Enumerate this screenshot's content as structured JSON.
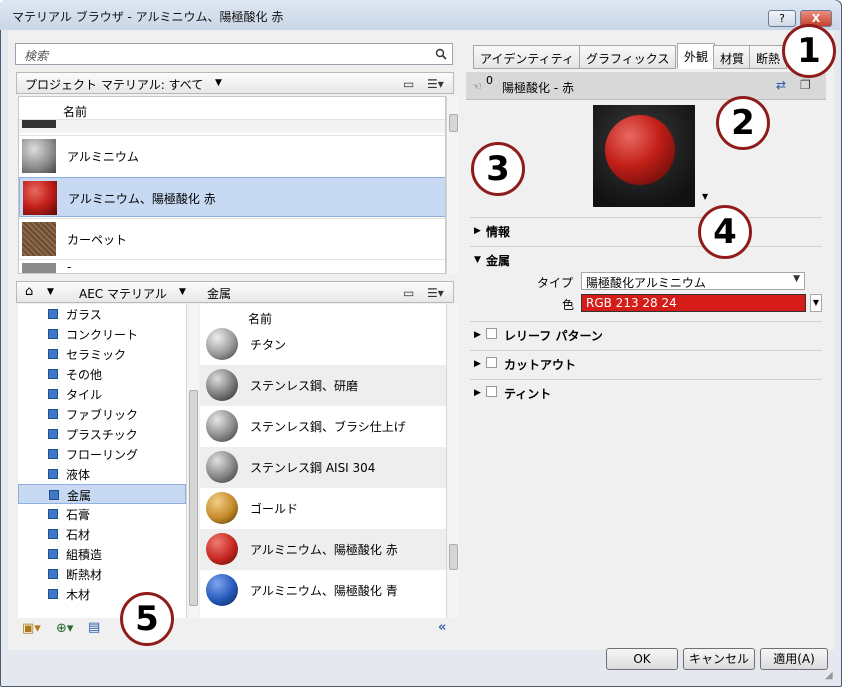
{
  "window": {
    "title": "マテリアル ブラウザ - アルミニウム、陽極酸化 赤",
    "help_label": "?",
    "close_label": "X"
  },
  "search": {
    "placeholder": "検索"
  },
  "project": {
    "dropdown_label": "プロジェクト マテリアル: すべて",
    "column_name": "名前",
    "items": [
      {
        "label": "アルミニウム",
        "icon": "sphere-gray"
      },
      {
        "label": "アルミニウム、陽極酸化 赤",
        "icon": "sphere-red",
        "selected": true
      },
      {
        "label": "カーペット",
        "icon": "texture-carpet"
      },
      {
        "label": "-",
        "icon": "texture-gray"
      }
    ]
  },
  "library": {
    "breadcrumb": [
      "AEC マテリアル",
      "金属"
    ],
    "column_name": "名前",
    "categories": [
      {
        "label": "ガラス"
      },
      {
        "label": "コンクリート"
      },
      {
        "label": "セラミック"
      },
      {
        "label": "その他"
      },
      {
        "label": "タイル"
      },
      {
        "label": "ファブリック"
      },
      {
        "label": "プラスチック"
      },
      {
        "label": "フローリング"
      },
      {
        "label": "液体"
      },
      {
        "label": "金属",
        "selected": true
      },
      {
        "label": "石膏"
      },
      {
        "label": "石材"
      },
      {
        "label": "組積造"
      },
      {
        "label": "断熱材"
      },
      {
        "label": "木材"
      }
    ],
    "items": [
      {
        "label": "チタン",
        "color": "#9a9a9a"
      },
      {
        "label": "ステンレス鋼、研磨",
        "color": "#7a7a7a"
      },
      {
        "label": "ステンレス鋼、ブラシ仕上げ",
        "color": "#8a8a8a"
      },
      {
        "label": "ステンレス鋼 AISI 304",
        "color": "#858585"
      },
      {
        "label": "ゴールド",
        "color": "#c48a2a"
      },
      {
        "label": "アルミニウム、陽極酸化 赤",
        "color": "#c62620"
      },
      {
        "label": "アルミニウム、陽極酸化 青",
        "color": "#2458b8"
      }
    ]
  },
  "tabs": [
    {
      "label": "アイデンティティ"
    },
    {
      "label": "グラフィックス"
    },
    {
      "label": "外観",
      "active": true
    },
    {
      "label": "材質"
    },
    {
      "label": "断熱"
    }
  ],
  "asset": {
    "count": "0",
    "name": "陽極酸化 - 赤"
  },
  "sections": {
    "info": "情報",
    "metal": "金属",
    "relief": "レリーフ パターン",
    "cutout": "カットアウト",
    "tint": "ティント"
  },
  "properties": {
    "type_label": "タイプ",
    "type_value": "陽極酸化アルミニウム",
    "color_label": "色",
    "color_value": "RGB 213 28 24",
    "color_hex": "#d51c18"
  },
  "buttons": {
    "ok": "OK",
    "cancel": "キャンセル",
    "apply": "適用(A)"
  },
  "callouts": [
    "1",
    "2",
    "3",
    "4",
    "5"
  ]
}
